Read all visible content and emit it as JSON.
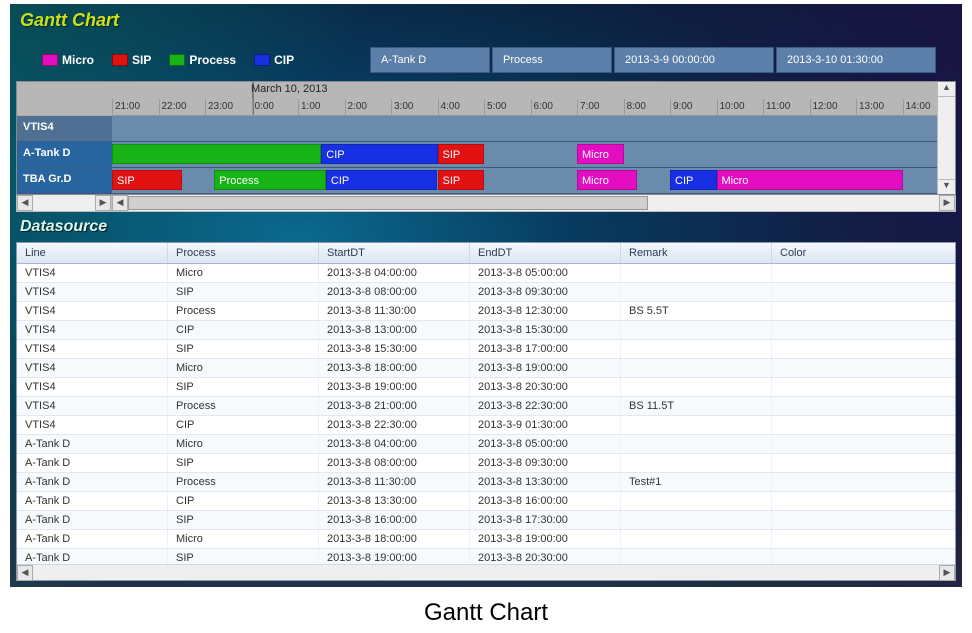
{
  "title": "Gantt Chart",
  "legend": [
    {
      "name": "Micro",
      "color": "#e30ec2"
    },
    {
      "name": "SIP",
      "color": "#e31212"
    },
    {
      "name": "Process",
      "color": "#17b317"
    },
    {
      "name": "CIP",
      "color": "#1730e3"
    }
  ],
  "info": {
    "line": "A-Tank D",
    "process": "Process",
    "start": "2013-3-9 00:00:00",
    "end": "2013-3-10 01:30:00"
  },
  "timeline": {
    "day_label": "March 10, 2013",
    "hours": [
      "21:00",
      "22:00",
      "23:00",
      "0:00",
      "1:00",
      "2:00",
      "3:00",
      "4:00",
      "5:00",
      "6:00",
      "7:00",
      "8:00",
      "9:00",
      "10:00",
      "11:00",
      "12:00",
      "13:00",
      "14:00"
    ]
  },
  "rows": [
    {
      "label": "VTIS4"
    },
    {
      "label": "A-Tank D"
    },
    {
      "label": "TBA Gr.D"
    }
  ],
  "chart_data": {
    "type": "gantt",
    "x_unit": "hour",
    "x_range": [
      21,
      38
    ],
    "bars": [
      {
        "row": 1,
        "label": "",
        "class": "process",
        "start_h": 21.0,
        "end_h": 25.5
      },
      {
        "row": 1,
        "label": "CIP",
        "class": "cip",
        "start_h": 25.5,
        "end_h": 28.0
      },
      {
        "row": 1,
        "label": "SIP",
        "class": "sip",
        "start_h": 28.0,
        "end_h": 29.0
      },
      {
        "row": 1,
        "label": "Micro",
        "class": "micro",
        "start_h": 31.0,
        "end_h": 32.0
      },
      {
        "row": 2,
        "label": "SIP",
        "class": "sip",
        "start_h": 21.0,
        "end_h": 22.5
      },
      {
        "row": 2,
        "label": "Process",
        "class": "process",
        "start_h": 23.2,
        "end_h": 25.6
      },
      {
        "row": 2,
        "label": "CIP",
        "class": "cip",
        "start_h": 25.6,
        "end_h": 28.0
      },
      {
        "row": 2,
        "label": "SIP",
        "class": "sip",
        "start_h": 28.0,
        "end_h": 29.0
      },
      {
        "row": 2,
        "label": "Micro",
        "class": "micro",
        "start_h": 31.0,
        "end_h": 32.3
      },
      {
        "row": 2,
        "label": "CIP",
        "class": "cip",
        "start_h": 33.0,
        "end_h": 34.0
      },
      {
        "row": 2,
        "label": "Micro",
        "class": "micro",
        "start_h": 34.0,
        "end_h": 38.0
      }
    ]
  },
  "datasource": {
    "title": "Datasource",
    "columns": [
      "Line",
      "Process",
      "StartDT",
      "EndDT",
      "Remark",
      "Color"
    ],
    "rows": [
      {
        "Line": "VTIS4",
        "Process": "Micro",
        "StartDT": "2013-3-8 04:00:00",
        "EndDT": "2013-3-8 05:00:00",
        "Remark": "",
        "Color": ""
      },
      {
        "Line": "VTIS4",
        "Process": "SIP",
        "StartDT": "2013-3-8 08:00:00",
        "EndDT": "2013-3-8 09:30:00",
        "Remark": "",
        "Color": ""
      },
      {
        "Line": "VTIS4",
        "Process": "Process",
        "StartDT": "2013-3-8 11:30:00",
        "EndDT": "2013-3-8 12:30:00",
        "Remark": "BS 5.5T",
        "Color": ""
      },
      {
        "Line": "VTIS4",
        "Process": "CIP",
        "StartDT": "2013-3-8 13:00:00",
        "EndDT": "2013-3-8 15:30:00",
        "Remark": "",
        "Color": ""
      },
      {
        "Line": "VTIS4",
        "Process": "SIP",
        "StartDT": "2013-3-8 15:30:00",
        "EndDT": "2013-3-8 17:00:00",
        "Remark": "",
        "Color": ""
      },
      {
        "Line": "VTIS4",
        "Process": "Micro",
        "StartDT": "2013-3-8 18:00:00",
        "EndDT": "2013-3-8 19:00:00",
        "Remark": "",
        "Color": ""
      },
      {
        "Line": "VTIS4",
        "Process": "SIP",
        "StartDT": "2013-3-8 19:00:00",
        "EndDT": "2013-3-8 20:30:00",
        "Remark": "",
        "Color": ""
      },
      {
        "Line": "VTIS4",
        "Process": "Process",
        "StartDT": "2013-3-8 21:00:00",
        "EndDT": "2013-3-8 22:30:00",
        "Remark": "BS 11.5T",
        "Color": ""
      },
      {
        "Line": "VTIS4",
        "Process": "CIP",
        "StartDT": "2013-3-8 22:30:00",
        "EndDT": "2013-3-9 01:30:00",
        "Remark": "",
        "Color": ""
      },
      {
        "Line": "A-Tank D",
        "Process": "Micro",
        "StartDT": "2013-3-8 04:00:00",
        "EndDT": "2013-3-8 05:00:00",
        "Remark": "",
        "Color": ""
      },
      {
        "Line": "A-Tank D",
        "Process": "SIP",
        "StartDT": "2013-3-8 08:00:00",
        "EndDT": "2013-3-8 09:30:00",
        "Remark": "",
        "Color": ""
      },
      {
        "Line": "A-Tank D",
        "Process": "Process",
        "StartDT": "2013-3-8 11:30:00",
        "EndDT": "2013-3-8 13:30:00",
        "Remark": "Test#1",
        "Color": ""
      },
      {
        "Line": "A-Tank D",
        "Process": "CIP",
        "StartDT": "2013-3-8 13:30:00",
        "EndDT": "2013-3-8 16:00:00",
        "Remark": "",
        "Color": ""
      },
      {
        "Line": "A-Tank D",
        "Process": "SIP",
        "StartDT": "2013-3-8 16:00:00",
        "EndDT": "2013-3-8 17:30:00",
        "Remark": "",
        "Color": ""
      },
      {
        "Line": "A-Tank D",
        "Process": "Micro",
        "StartDT": "2013-3-8 18:00:00",
        "EndDT": "2013-3-8 19:00:00",
        "Remark": "",
        "Color": ""
      },
      {
        "Line": "A-Tank D",
        "Process": "SIP",
        "StartDT": "2013-3-8 19:00:00",
        "EndDT": "2013-3-8 20:30:00",
        "Remark": "",
        "Color": ""
      }
    ]
  },
  "caption": "Gantt Chart"
}
